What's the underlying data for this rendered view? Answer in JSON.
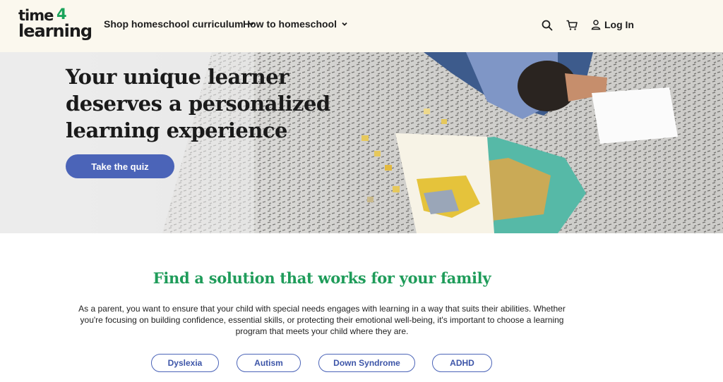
{
  "header": {
    "logo": {
      "line1": "time",
      "four": "4",
      "line2": "learning"
    },
    "nav": [
      {
        "label": "Shop homeschool curriculum"
      },
      {
        "label": "How to homeschool"
      }
    ],
    "icons": {
      "search": "search-icon",
      "cart": "cart-icon",
      "user": "user-icon",
      "chevron": "chevron-down-icon"
    },
    "login_label": "Log In"
  },
  "hero": {
    "title": "Your unique learner deserves a personalized learning experience",
    "cta_label": "Take the quiz"
  },
  "solutions": {
    "title": "Find a solution that works for your family",
    "body": "As a parent, you want to ensure that your child with special needs engages with learning in a way that suits their abilities. Whether you're focusing on building confidence, essential skills, or protecting their emotional well-being, it's important to choose a learning program that meets your child where they are.",
    "pills": [
      "Dyslexia",
      "Autism",
      "Down Syndrome",
      "ADHD"
    ]
  },
  "colors": {
    "header_bg": "#fbf8ee",
    "accent_blue": "#4b64b8",
    "accent_green": "#1f9c5a"
  }
}
